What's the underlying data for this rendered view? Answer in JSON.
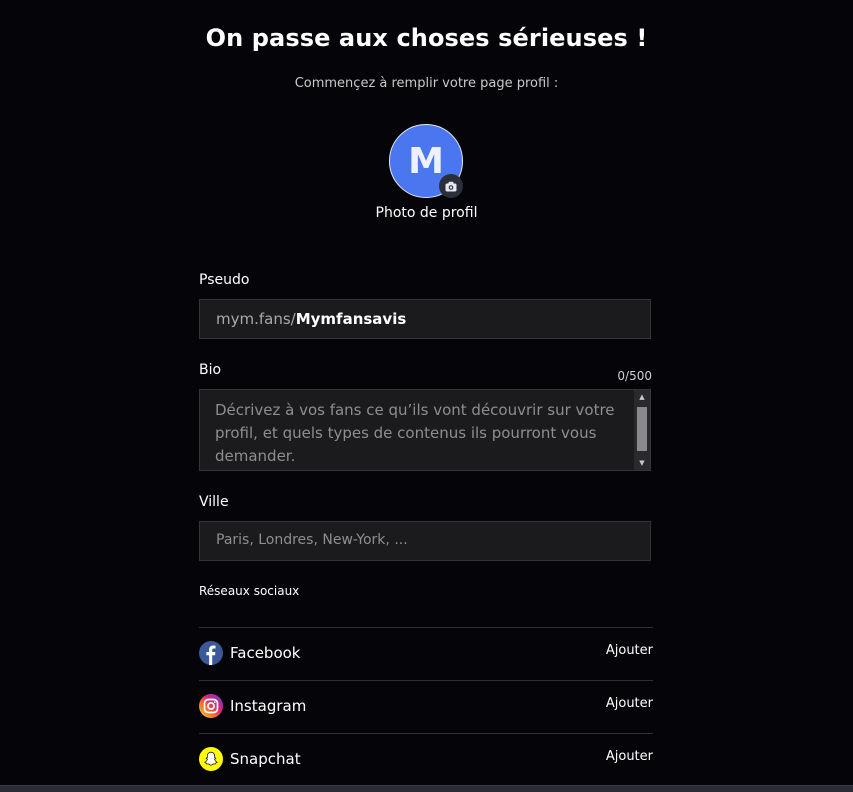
{
  "header": {
    "title": "On passe aux choses sérieuses !",
    "subtitle": "Commençez à remplir votre page profil :"
  },
  "avatar": {
    "initial": "M",
    "label": "Photo de profil",
    "color": "#4a76f0",
    "camera_icon": "camera-icon"
  },
  "pseudo": {
    "label": "Pseudo",
    "prefix": "mym.fans/",
    "value": "Mymfansavis"
  },
  "bio": {
    "label": "Bio",
    "counter": "0/500",
    "placeholder": "Décrivez à vos fans ce qu’ils vont découvrir sur votre profil, et quels types de contenus ils pourront vous demander."
  },
  "ville": {
    "label": "Ville",
    "placeholder": "Paris, Londres, New-York, ..."
  },
  "social": {
    "title": "Réseaux sociaux",
    "items": [
      {
        "name": "Facebook",
        "action": "Ajouter",
        "icon": "facebook-icon",
        "color": "#3b5998"
      },
      {
        "name": "Instagram",
        "action": "Ajouter",
        "icon": "instagram-icon",
        "color": "#e1306c"
      },
      {
        "name": "Snapchat",
        "action": "Ajouter",
        "icon": "snapchat-icon",
        "color": "#fffc00"
      }
    ]
  }
}
